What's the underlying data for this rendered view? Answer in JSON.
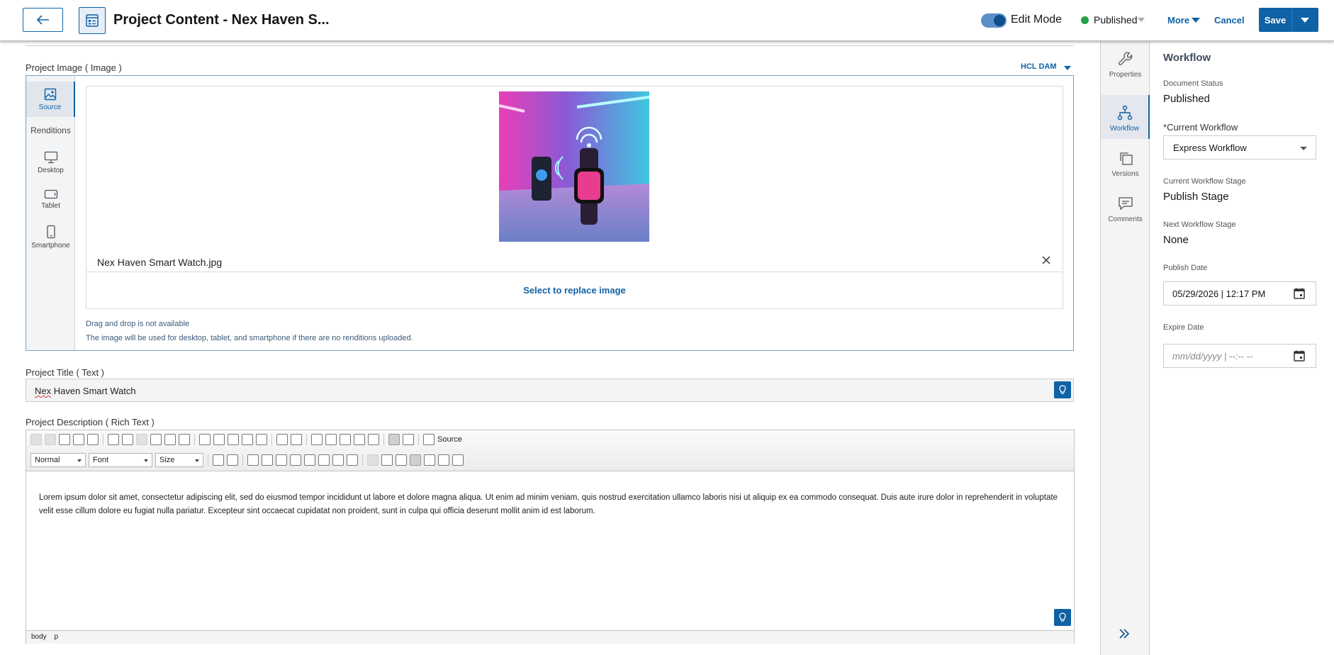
{
  "header": {
    "title": "Project Content - Nex Haven S...",
    "edit_mode_label": "Edit Mode",
    "status_label": "Published",
    "more_label": "More",
    "cancel_label": "Cancel",
    "save_label": "Save"
  },
  "image_field": {
    "label": "Project Image ( Image )",
    "dam_label": "HCL DAM",
    "renditions": {
      "source": "Source",
      "heading": "Renditions",
      "desktop": "Desktop",
      "tablet": "Tablet",
      "smartphone": "Smartphone"
    },
    "file_name": "Nex Haven Smart Watch.jpg",
    "replace_label": "Select to replace image",
    "note_drag": "Drag and drop is not available",
    "note_usage": "The image will be used for desktop, tablet, and smartphone if there are no renditions uploaded."
  },
  "title_field": {
    "label": "Project Title ( Text )",
    "value_word1": "Nex",
    "value_rest": " Haven Smart Watch"
  },
  "description_field": {
    "label": "Project Description ( Rich Text )",
    "source_label": "Source",
    "format_combo": "Normal",
    "font_combo": "Font",
    "size_combo": "Size",
    "body": "Lorem ipsum dolor sit amet, consectetur adipiscing elit, sed do eiusmod tempor incididunt ut labore et dolore magna aliqua. Ut enim ad minim veniam, quis nostrud exercitation ullamco laboris nisi ut aliquip ex ea commodo consequat. Duis aute irure dolor in reprehenderit in voluptate velit esse cillum dolore eu fugiat nulla pariatur. Excepteur sint occaecat cupidatat non proident, sunt in culpa qui officia deserunt mollit anim id est laborum.",
    "status_path": [
      "body",
      "p"
    ]
  },
  "rail": {
    "properties": "Properties",
    "workflow": "Workflow",
    "versions": "Versions",
    "comments": "Comments"
  },
  "workflow_panel": {
    "title": "Workflow",
    "document_status_label": "Document Status",
    "document_status_value": "Published",
    "current_workflow_required": "*",
    "current_workflow_label": "Current Workflow",
    "current_workflow_value": "Express Workflow",
    "current_stage_label": "Current Workflow Stage",
    "current_stage_value": "Publish Stage",
    "next_stage_label": "Next Workflow Stage",
    "next_stage_value": "None",
    "publish_date_label": "Publish Date",
    "publish_date_value": "05/29/2026 | 12:17 PM",
    "expire_date_label": "Expire Date",
    "expire_date_placeholder": "mm/dd/yyyy | --:-- --"
  },
  "colors": {
    "accent": "#0f62a6",
    "status_green": "#24a148"
  }
}
